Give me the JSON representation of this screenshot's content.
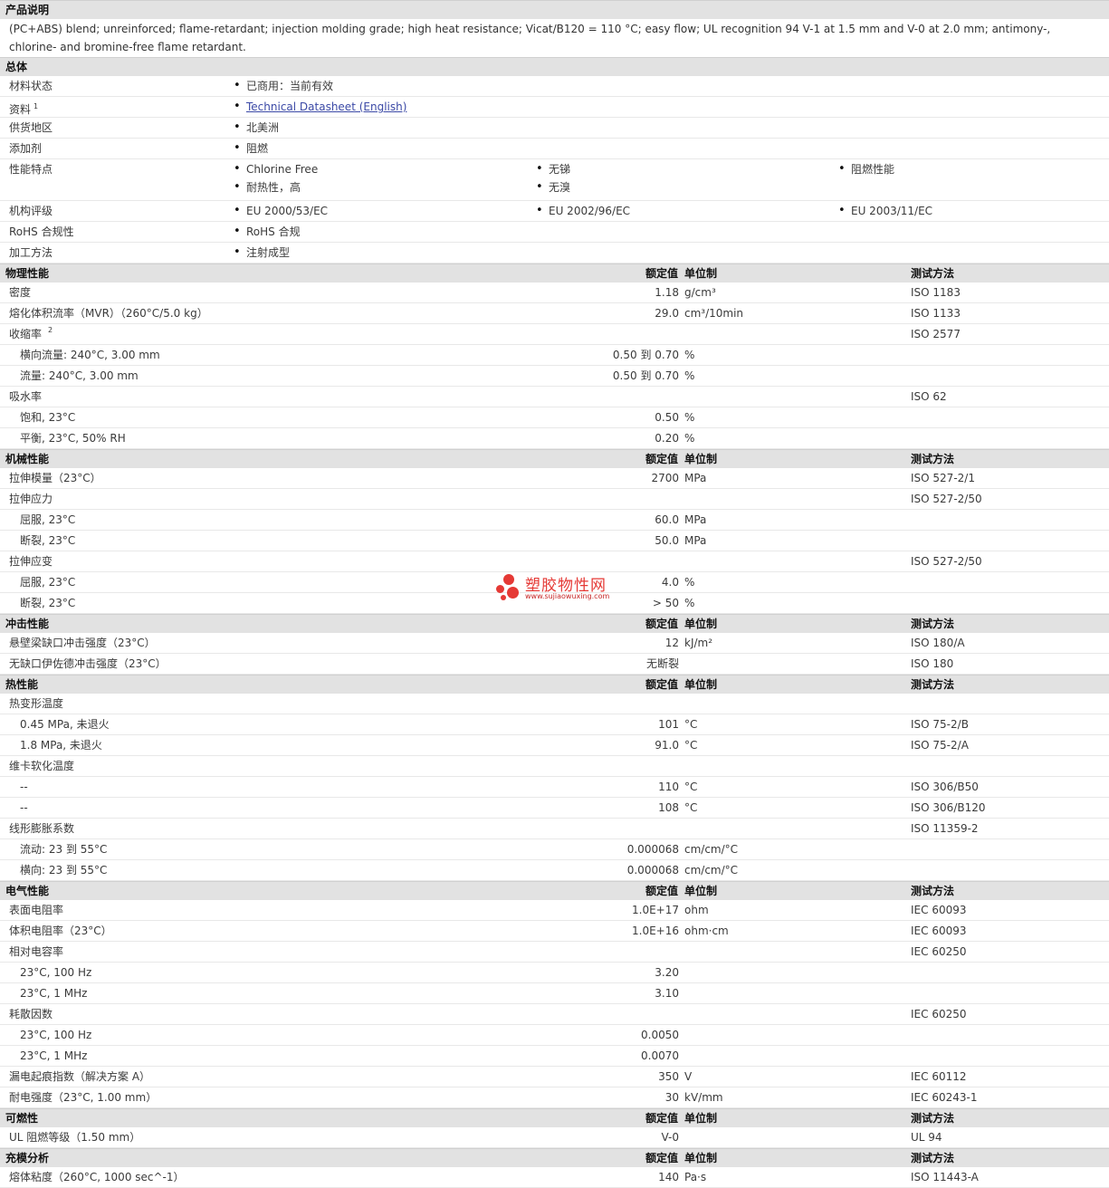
{
  "desc_title": "产品说明",
  "description": "(PC+ABS) blend; unreinforced; flame-retardant; injection molding grade; high heat resistance; Vicat/B120 = 110 °C; easy flow; UL recognition 94 V-1 at 1.5 mm and V-0 at 2.0 mm; antimony-, chlorine- and bromine-free flame retardant.",
  "general": {
    "title": "总体",
    "rows": [
      {
        "label": "材料状态",
        "items": [
          "已商用：当前有效"
        ]
      },
      {
        "label": "资料",
        "sup": "1",
        "items": [
          "Technical Datasheet (English)"
        ]
      },
      {
        "label": "供货地区",
        "items": [
          "北美洲"
        ]
      },
      {
        "label": "添加剂",
        "items": [
          "阻燃"
        ]
      },
      {
        "label": "性能特点",
        "items": [
          "Chlorine Free",
          "无锑",
          "阻燃性能",
          "耐热性，高",
          "无溴"
        ]
      },
      {
        "label": "机构评级",
        "items": [
          "EU 2000/53/EC",
          "EU 2002/96/EC",
          "EU 2003/11/EC"
        ]
      },
      {
        "label": "RoHS 合规性",
        "items": [
          "RoHS 合规"
        ]
      },
      {
        "label": "加工方法",
        "items": [
          "注射成型"
        ]
      }
    ]
  },
  "headers": {
    "nominal": "额定值",
    "unit": "单位制",
    "method": "测试方法"
  },
  "sections": [
    {
      "title": "物理性能",
      "rows": [
        {
          "label": "密度",
          "value": "1.18",
          "unit": "g/cm³",
          "method": "ISO 1183"
        },
        {
          "label": "熔化体积流率（MVR）（260°C/5.0 kg）",
          "value": "29.0",
          "unit": "cm³/10min",
          "method": "ISO 1133"
        },
        {
          "label": "收缩率",
          "sup": "2",
          "method": "ISO 2577"
        },
        {
          "label": "横向流量: 240°C, 3.00 mm",
          "sub": true,
          "value": "0.50 到  0.70",
          "unit": "%"
        },
        {
          "label": "流量: 240°C, 3.00 mm",
          "sub": true,
          "value": "0.50 到  0.70",
          "unit": "%"
        },
        {
          "label": "吸水率",
          "method": "ISO 62"
        },
        {
          "label": "饱和, 23°C",
          "sub": true,
          "value": "0.50",
          "unit": "%"
        },
        {
          "label": "平衡, 23°C, 50% RH",
          "sub": true,
          "value": "0.20",
          "unit": "%"
        }
      ]
    },
    {
      "title": "机械性能",
      "rows": [
        {
          "label": "拉伸模量（23°C）",
          "value": "2700",
          "unit": "MPa",
          "method": "ISO 527-2/1"
        },
        {
          "label": "拉伸应力",
          "method": "ISO 527-2/50"
        },
        {
          "label": "屈服, 23°C",
          "sub": true,
          "value": "60.0",
          "unit": "MPa"
        },
        {
          "label": "断裂, 23°C",
          "sub": true,
          "value": "50.0",
          "unit": "MPa"
        },
        {
          "label": "拉伸应变",
          "method": "ISO 527-2/50"
        },
        {
          "label": "屈服, 23°C",
          "sub": true,
          "value": "4.0",
          "unit": "%"
        },
        {
          "label": "断裂, 23°C",
          "sub": true,
          "value": "> 50",
          "unit": "%"
        }
      ]
    },
    {
      "title": "冲击性能",
      "rows": [
        {
          "label": "悬壁梁缺口冲击强度（23°C）",
          "value": "12",
          "unit": "kJ/m²",
          "method": "ISO 180/A"
        },
        {
          "label": "无缺口伊佐德冲击强度（23°C）",
          "value": "无断裂",
          "method": "ISO 180"
        }
      ]
    },
    {
      "title": "热性能",
      "rows": [
        {
          "label": "热变形温度"
        },
        {
          "label": "0.45 MPa, 未退火",
          "sub": true,
          "value": "101",
          "unit": "°C",
          "method": "ISO 75-2/B"
        },
        {
          "label": "1.8 MPa, 未退火",
          "sub": true,
          "value": "91.0",
          "unit": "°C",
          "method": "ISO 75-2/A"
        },
        {
          "label": "维卡软化温度"
        },
        {
          "label": "--",
          "sub": true,
          "value": "110",
          "unit": "°C",
          "method": "ISO 306/B50"
        },
        {
          "label": "--",
          "sub": true,
          "value": "108",
          "unit": "°C",
          "method": "ISO 306/B120"
        },
        {
          "label": "线形膨胀系数",
          "method": "ISO 11359-2"
        },
        {
          "label": "流动: 23 到  55°C",
          "sub": true,
          "value": "0.000068",
          "unit": "cm/cm/°C"
        },
        {
          "label": "横向: 23 到  55°C",
          "sub": true,
          "value": "0.000068",
          "unit": "cm/cm/°C"
        }
      ]
    },
    {
      "title": "电气性能",
      "rows": [
        {
          "label": "表面电阻率",
          "value": "1.0E+17",
          "unit": "ohm",
          "method": "IEC 60093"
        },
        {
          "label": "体积电阻率（23°C）",
          "value": "1.0E+16",
          "unit": "ohm·cm",
          "method": "IEC 60093"
        },
        {
          "label": "相对电容率",
          "method": "IEC 60250"
        },
        {
          "label": "23°C, 100 Hz",
          "sub": true,
          "value": "3.20"
        },
        {
          "label": "23°C, 1 MHz",
          "sub": true,
          "value": "3.10"
        },
        {
          "label": "耗散因数",
          "method": "IEC 60250"
        },
        {
          "label": "23°C, 100 Hz",
          "sub": true,
          "value": "0.0050"
        },
        {
          "label": "23°C, 1 MHz",
          "sub": true,
          "value": "0.0070"
        },
        {
          "label": "漏电起痕指数（解决方案  A）",
          "value": "350",
          "unit": "V",
          "method": "IEC 60112"
        },
        {
          "label": "耐电强度（23°C, 1.00 mm）",
          "value": "30",
          "unit": "kV/mm",
          "method": "IEC 60243-1"
        }
      ]
    },
    {
      "title": "可燃性",
      "rows": [
        {
          "label": "UL 阻燃等级（1.50 mm）",
          "value": "V-0",
          "method": "UL 94"
        }
      ]
    },
    {
      "title": "充模分析",
      "rows": [
        {
          "label": "熔体粘度（260°C, 1000 sec^-1）",
          "value": "140",
          "unit": "Pa·s",
          "method": "ISO 11443-A"
        }
      ]
    }
  ],
  "watermark": {
    "title": "塑胶物性网",
    "url": "www.sujiaowuxing.com"
  }
}
